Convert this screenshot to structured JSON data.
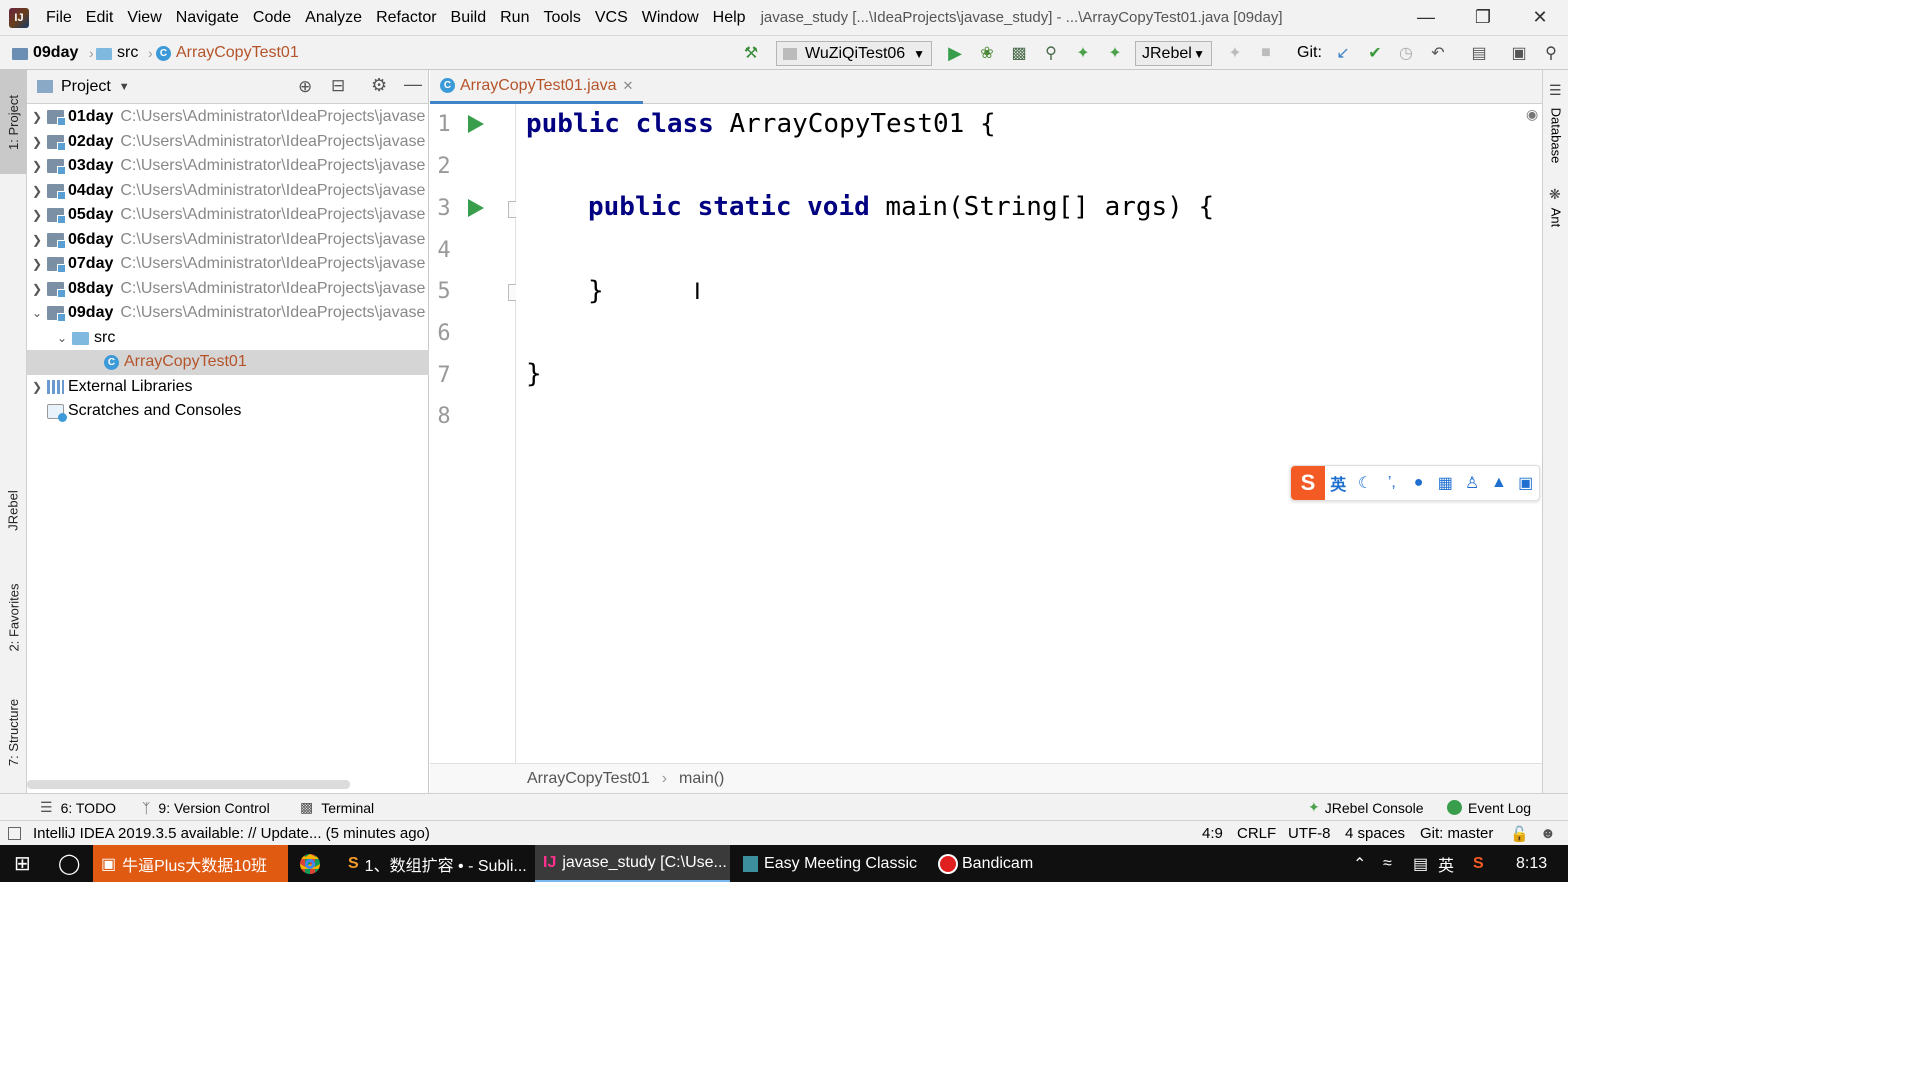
{
  "menubar": {
    "logo": "IJ",
    "items": [
      "File",
      "Edit",
      "View",
      "Navigate",
      "Code",
      "Analyze",
      "Refactor",
      "Build",
      "Run",
      "Tools",
      "VCS",
      "Window",
      "Help"
    ],
    "title": "javase_study [...\\IdeaProjects\\javase_study] - ...\\ArrayCopyTest01.java [09day]"
  },
  "navbar": {
    "crumbs": [
      "09day",
      "src",
      "ArrayCopyTest01"
    ],
    "run_config": "WuZiQiTest06",
    "jrebel_combo": "JRebel",
    "git_label": "Git:"
  },
  "left_stripe": {
    "project": "1: Project",
    "jrebel": "JRebel",
    "favorites": "2: Favorites",
    "structure": "7: Structure"
  },
  "project_panel": {
    "title": "Project",
    "rows": [
      {
        "name": "01day",
        "path": "C:\\Users\\Administrator\\IdeaProjects\\javase"
      },
      {
        "name": "02day",
        "path": "C:\\Users\\Administrator\\IdeaProjects\\javase"
      },
      {
        "name": "03day",
        "path": "C:\\Users\\Administrator\\IdeaProjects\\javase"
      },
      {
        "name": "04day",
        "path": "C:\\Users\\Administrator\\IdeaProjects\\javase"
      },
      {
        "name": "05day",
        "path": "C:\\Users\\Administrator\\IdeaProjects\\javase"
      },
      {
        "name": "06day",
        "path": "C:\\Users\\Administrator\\IdeaProjects\\javase"
      },
      {
        "name": "07day",
        "path": "C:\\Users\\Administrator\\IdeaProjects\\javase"
      },
      {
        "name": "08day",
        "path": "C:\\Users\\Administrator\\IdeaProjects\\javase"
      },
      {
        "name": "09day",
        "path": "C:\\Users\\Administrator\\IdeaProjects\\javase"
      }
    ],
    "src": "src",
    "selected_file": "ArrayCopyTest01",
    "external_libraries": "External Libraries",
    "scratches": "Scratches and Consoles"
  },
  "editor": {
    "tab_label": "ArrayCopyTest01.java",
    "line_numbers": [
      "1",
      "2",
      "3",
      "4",
      "5",
      "6",
      "7",
      "8"
    ],
    "lines": {
      "l1_kw": "public class",
      "l1_rest": " ArrayCopyTest01 {",
      "l3_kw": "public static void",
      "l3_rest": " main(String[] args) {",
      "l5": "}",
      "l7": "}"
    },
    "breadcrumb": [
      "ArrayCopyTest01",
      "main()"
    ]
  },
  "right_stripe": {
    "database": "Database",
    "ant": "Ant"
  },
  "ime": {
    "lang": "英"
  },
  "bottom_tools": {
    "todo": "6: TODO",
    "vcs": "9: Version Control",
    "terminal": "Terminal",
    "jrebel_console": "JRebel Console",
    "event_log": "Event Log"
  },
  "status": {
    "message": "IntelliJ IDEA 2019.3.5 available: // Update... (5 minutes ago)",
    "position": "4:9",
    "line_sep": "CRLF",
    "encoding": "UTF-8",
    "indent": "4 spaces",
    "git": "Git: master"
  },
  "taskbar": {
    "apps": [
      "牛逼Plus大数据10班",
      "1、数组扩容 • - Subli...",
      "javase_study [C:\\Use...",
      "Easy Meeting Classic",
      "Bandicam"
    ],
    "ime": "英",
    "time": "8:13"
  },
  "colors": {
    "keyword": "#000080",
    "run_green": "#389e4c",
    "caret_row": "#fdfbe6",
    "accent_tab": "#4083c9"
  }
}
